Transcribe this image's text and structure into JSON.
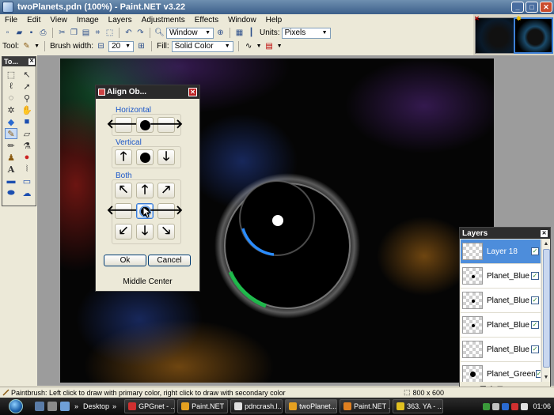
{
  "window": {
    "title": "twoPlanets.pdn (100%) - Paint.NET v3.22"
  },
  "menu": [
    "File",
    "Edit",
    "View",
    "Image",
    "Layers",
    "Adjustments",
    "Effects",
    "Window",
    "Help"
  ],
  "toolbar": {
    "zoom_value": "Window",
    "units_label": "Units:",
    "units_value": "Pixels"
  },
  "tool_options": {
    "tool_label": "Tool:",
    "brush_width_label": "Brush width:",
    "brush_width_value": "20",
    "fill_label": "Fill:",
    "fill_value": "Solid Color"
  },
  "tools_panel": {
    "title": "To..."
  },
  "align_dialog": {
    "title": "Align Ob...",
    "horizontal_label": "Horizontal",
    "vertical_label": "Vertical",
    "both_label": "Both",
    "ok_label": "Ok",
    "cancel_label": "Cancel",
    "status": "Middle Center"
  },
  "layers_panel": {
    "title": "Layers",
    "items": [
      {
        "name": "Layer 18",
        "selected": true
      },
      {
        "name": "Planet_Blue",
        "selected": false
      },
      {
        "name": "Planet_Blue",
        "selected": false
      },
      {
        "name": "Planet_Blue",
        "selected": false
      },
      {
        "name": "Planet_Blue",
        "selected": false
      },
      {
        "name": "Planet_Green",
        "selected": false
      }
    ]
  },
  "status": {
    "text": "Paintbrush: Left click to draw with primary color, right click to draw with secondary color",
    "size": "800 x 600"
  },
  "taskbar": {
    "desktop_label": "Desktop",
    "tasks": [
      "GPGnet - ...",
      "Paint.NET",
      "pdncrash.l...",
      "twoPlanet...",
      "Paint.NET ...",
      "363. YA - ..."
    ],
    "clock": "01:06"
  },
  "colors": {
    "accent": "#3c7fd6",
    "planet_rim_blue": "#2a8cff",
    "planet_rim_green": "#19c24a"
  }
}
